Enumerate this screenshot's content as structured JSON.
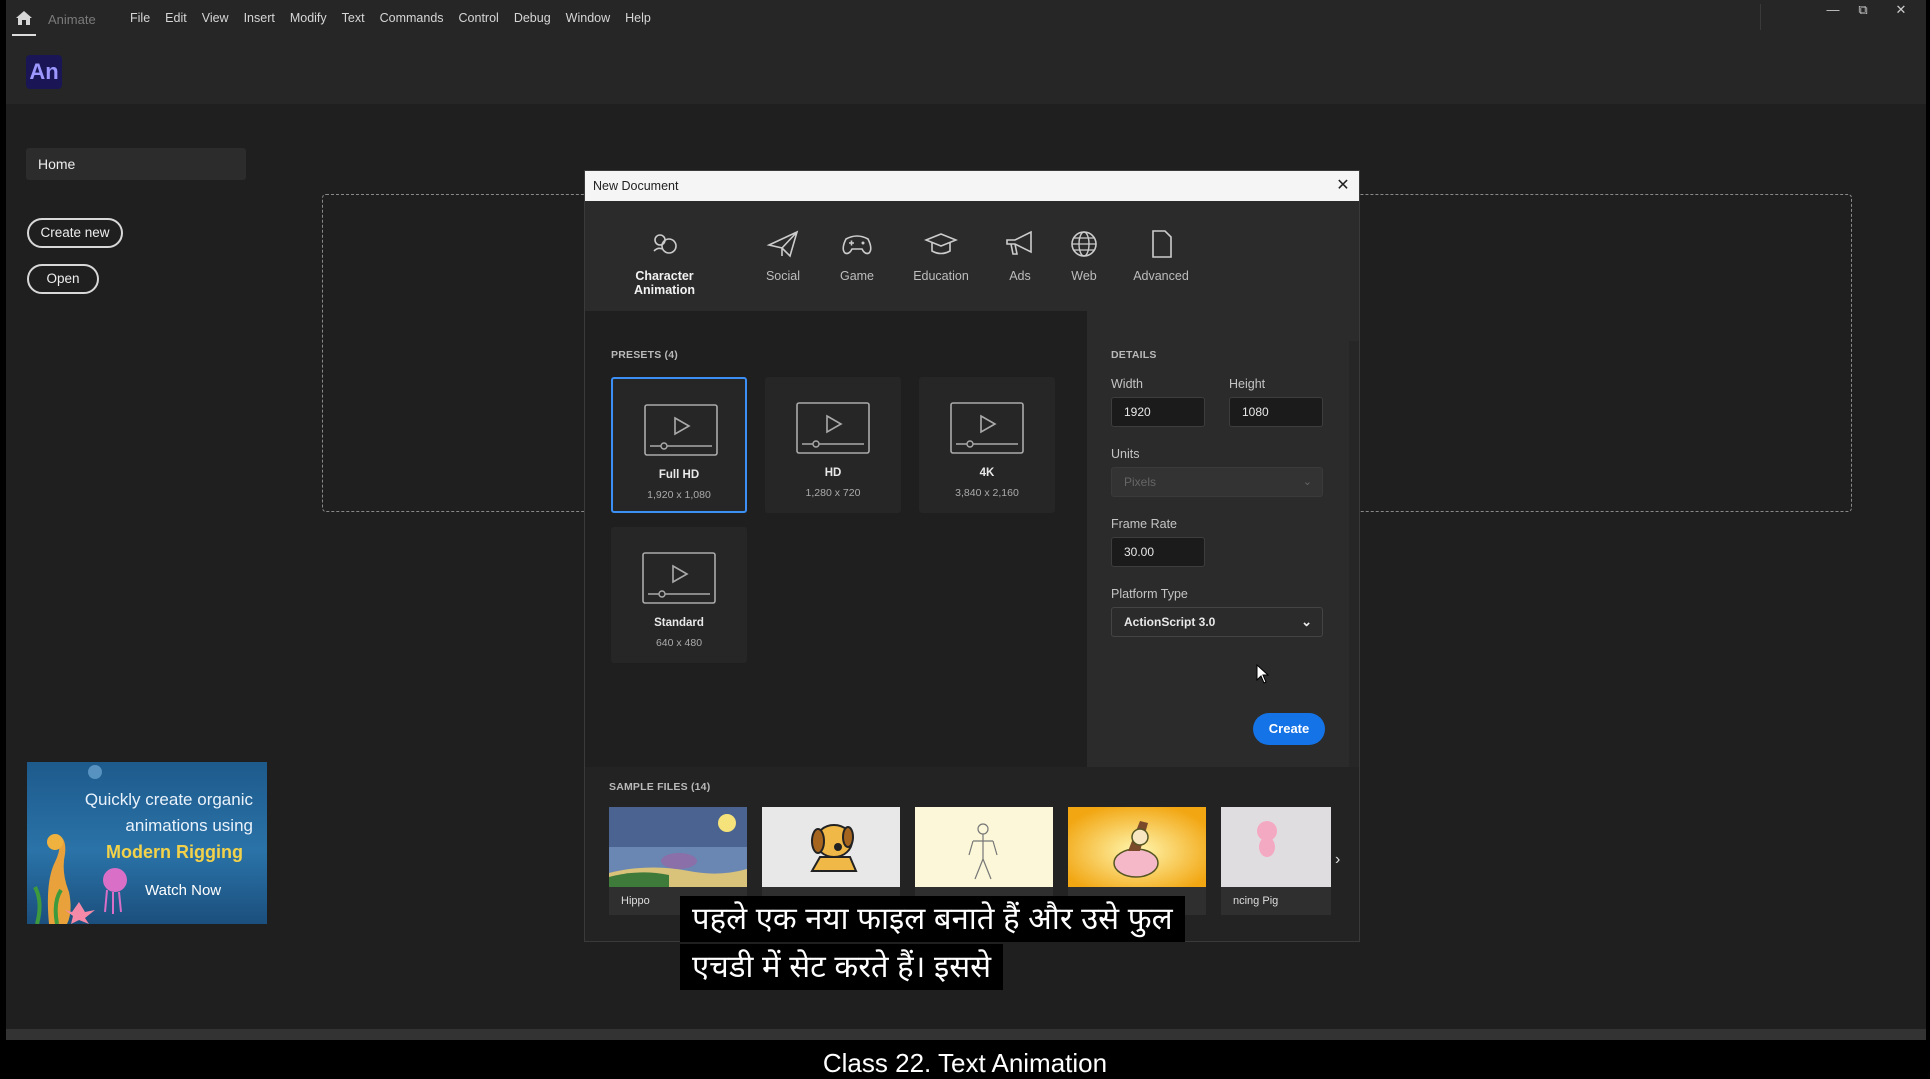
{
  "app": {
    "name": "Animate",
    "logo_text": "An"
  },
  "menu": [
    "File",
    "Edit",
    "View",
    "Insert",
    "Modify",
    "Text",
    "Commands",
    "Control",
    "Debug",
    "Window",
    "Help"
  ],
  "sidebar": {
    "home": "Home",
    "create_new": "Create new",
    "open": "Open"
  },
  "promo": {
    "line1": "Quickly create organic",
    "line2": "animations using",
    "line3": "Modern Rigging",
    "cta": "Watch Now"
  },
  "dialog": {
    "title": "New Document",
    "categories": [
      "Character Animation",
      "Social",
      "Game",
      "Education",
      "Ads",
      "Web",
      "Advanced"
    ],
    "presets_label": "PRESETS (4)",
    "presets": [
      {
        "name": "Full HD",
        "size": "1,920 x 1,080"
      },
      {
        "name": "HD",
        "size": "1,280 x 720"
      },
      {
        "name": "4K",
        "size": "3,840 x 2,160"
      },
      {
        "name": "Standard",
        "size": "640 x 480"
      }
    ],
    "details": {
      "label": "DETAILS",
      "width_label": "Width",
      "width_value": "1920",
      "height_label": "Height",
      "height_value": "1080",
      "units_label": "Units",
      "units_value": "Pixels",
      "frame_rate_label": "Frame Rate",
      "frame_rate_value": "30.00",
      "platform_label": "Platform Type",
      "platform_value": "ActionScript 3.0",
      "create": "Create"
    },
    "samples_label": "SAMPLE FILES (14)",
    "samples": [
      "Hippo",
      "",
      "",
      "",
      "ncing Pig"
    ]
  },
  "subtitle": {
    "line1": "पहले एक नया फाइल बनाते हैं और उसे फुल",
    "line2": "एचडी में सेट करते हैं। इससे"
  },
  "footer_title": "Class 22. Text Animation",
  "colors": {
    "accent": "#1473e6",
    "selected_border": "#3b8ff5",
    "logo_bg": "#1a1656"
  }
}
